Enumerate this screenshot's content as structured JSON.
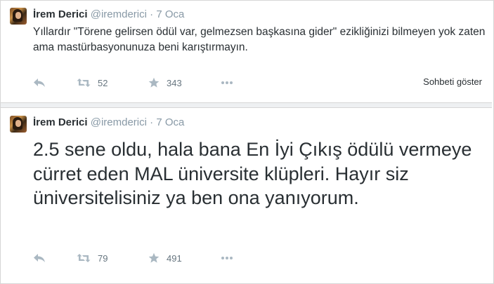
{
  "tweets": [
    {
      "name": "İrem Derici",
      "handle": "@iremderici",
      "separator": "·",
      "date": "7 Oca",
      "text": "Yıllardır \"Törene gelirsen ödül var, gelmezsen başkasına gider\" ezikliğinizi bilmeyen yok zaten ama mastürbasyonunuza beni karıştırmayın.",
      "retweets": "52",
      "favorites": "343",
      "conversation_link": "Sohbeti göster"
    },
    {
      "name": "İrem Derici",
      "handle": "@iremderici",
      "separator": "·",
      "date": "7 Oca",
      "text": "2.5 sene oldu, hala bana En İyi Çıkış ödülü vermeye cürret eden MAL üniversite klüpleri. Hayır siz üniversitelisiniz ya ben ona yanıyorum.",
      "retweets": "79",
      "favorites": "491"
    }
  ],
  "icons": {
    "reply": "reply-icon",
    "retweet": "retweet-icon",
    "favorite": "star-icon",
    "more": "more-icon"
  },
  "colors": {
    "text": "#292f33",
    "muted": "#8899a6",
    "icon": "#aab8c2"
  }
}
